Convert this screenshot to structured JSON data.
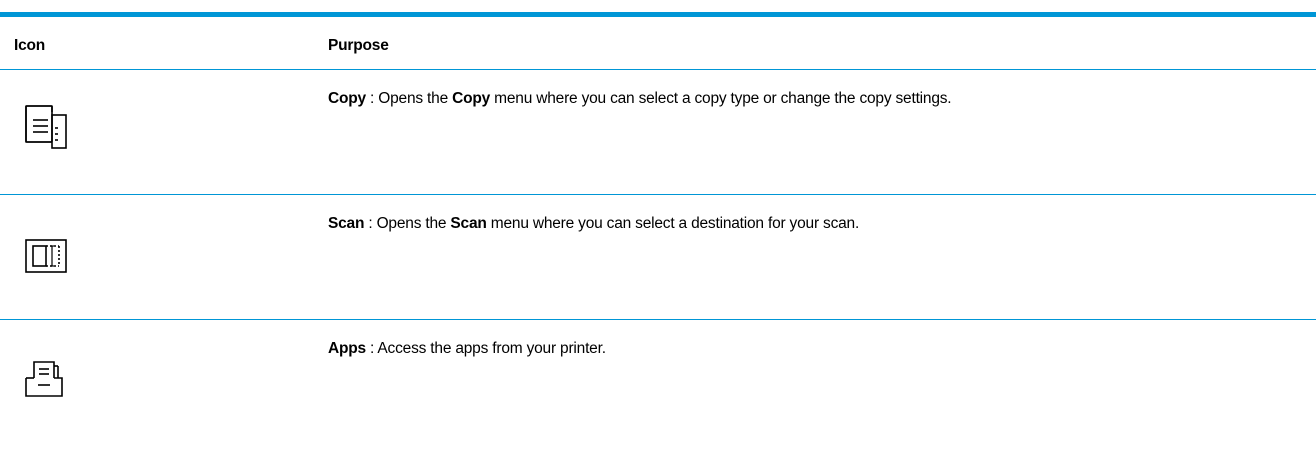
{
  "colors": {
    "accent": "#0096d6",
    "text": "#000000",
    "background": "#ffffff"
  },
  "header": {
    "icon_label": "Icon",
    "purpose_label": "Purpose"
  },
  "rows": [
    {
      "icon": "copy-icon",
      "name": "Copy",
      "sep": " : ",
      "text_a": "Opens the ",
      "menu": "Copy",
      "text_b": " menu where you can select a copy type or change the copy settings."
    },
    {
      "icon": "scan-icon",
      "name": "Scan",
      "sep": " : ",
      "text_a": "Opens the ",
      "menu": "Scan",
      "text_b": " menu where you can select a destination for your scan."
    },
    {
      "icon": "apps-icon",
      "name": "Apps",
      "sep": " : ",
      "text_a": "Access the apps from your printer."
    }
  ]
}
